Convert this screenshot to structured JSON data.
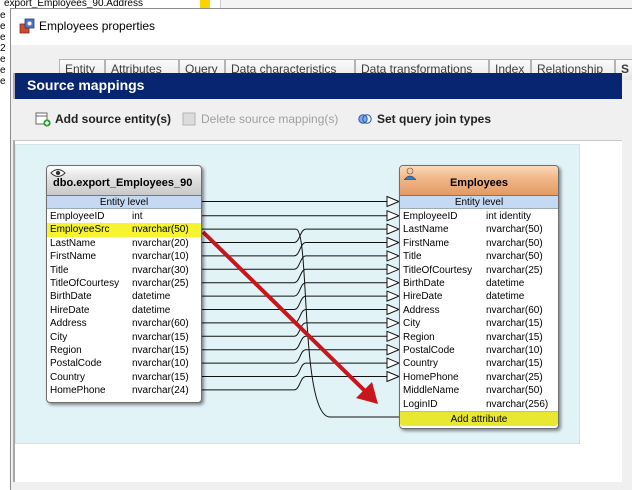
{
  "background": {
    "title_fragment": "export_Employees_90.Address",
    "left_letters": [
      "e",
      "e",
      "e",
      "2",
      "e",
      "e",
      "e"
    ]
  },
  "dialog": {
    "title": "Employees properties",
    "tabs": [
      {
        "label": "Entity"
      },
      {
        "label": "Attributes"
      },
      {
        "label": "Query"
      },
      {
        "label": "Data characteristics"
      },
      {
        "label": "Data transformations"
      },
      {
        "label": "Index"
      },
      {
        "label": "Relationship"
      },
      {
        "label": "S"
      }
    ],
    "section_title": "Source mappings",
    "toolbar": {
      "add_source": "Add source entity(s)",
      "delete_mapping": "Delete source mapping(s)",
      "set_join": "Set query join types"
    }
  },
  "source_entity": {
    "title": "dbo.export_Employees_90",
    "level_label": "Entity level",
    "rows": [
      {
        "name": "EmployeeID",
        "type": "int"
      },
      {
        "name": "EmployeeSrc",
        "type": "nvarchar(50)",
        "highlight": true
      },
      {
        "name": "LastName",
        "type": "nvarchar(20)"
      },
      {
        "name": "FirstName",
        "type": "nvarchar(10)"
      },
      {
        "name": "Title",
        "type": "nvarchar(30)"
      },
      {
        "name": "TitleOfCourtesy",
        "type": "nvarchar(25)"
      },
      {
        "name": "BirthDate",
        "type": "datetime"
      },
      {
        "name": "HireDate",
        "type": "datetime"
      },
      {
        "name": "Address",
        "type": "nvarchar(60)"
      },
      {
        "name": "City",
        "type": "nvarchar(15)"
      },
      {
        "name": "Region",
        "type": "nvarchar(15)"
      },
      {
        "name": "PostalCode",
        "type": "nvarchar(10)"
      },
      {
        "name": "Country",
        "type": "nvarchar(15)"
      },
      {
        "name": "HomePhone",
        "type": "nvarchar(24)"
      }
    ]
  },
  "target_entity": {
    "title": "Employees",
    "level_label": "Entity level",
    "rows": [
      {
        "name": "EmployeeID",
        "type": "int identity"
      },
      {
        "name": "LastName",
        "type": "nvarchar(50)"
      },
      {
        "name": "FirstName",
        "type": "nvarchar(50)"
      },
      {
        "name": "Title",
        "type": "nvarchar(50)"
      },
      {
        "name": "TitleOfCourtesy",
        "type": "nvarchar(25)"
      },
      {
        "name": "BirthDate",
        "type": "datetime"
      },
      {
        "name": "HireDate",
        "type": "datetime"
      },
      {
        "name": "Address",
        "type": "nvarchar(60)"
      },
      {
        "name": "City",
        "type": "nvarchar(15)"
      },
      {
        "name": "Region",
        "type": "nvarchar(15)"
      },
      {
        "name": "PostalCode",
        "type": "nvarchar(10)"
      },
      {
        "name": "Country",
        "type": "nvarchar(15)"
      },
      {
        "name": "HomePhone",
        "type": "nvarchar(25)"
      },
      {
        "name": "MiddleName",
        "type": "nvarchar(50)"
      },
      {
        "name": "LoginID",
        "type": "nvarchar(256)"
      }
    ],
    "add_attribute": "Add attribute"
  },
  "colors": {
    "header_band": "#082571",
    "canvas": "#e2f3f8",
    "highlight": "#f6f430",
    "annotation_arrow": "#c8161d"
  }
}
